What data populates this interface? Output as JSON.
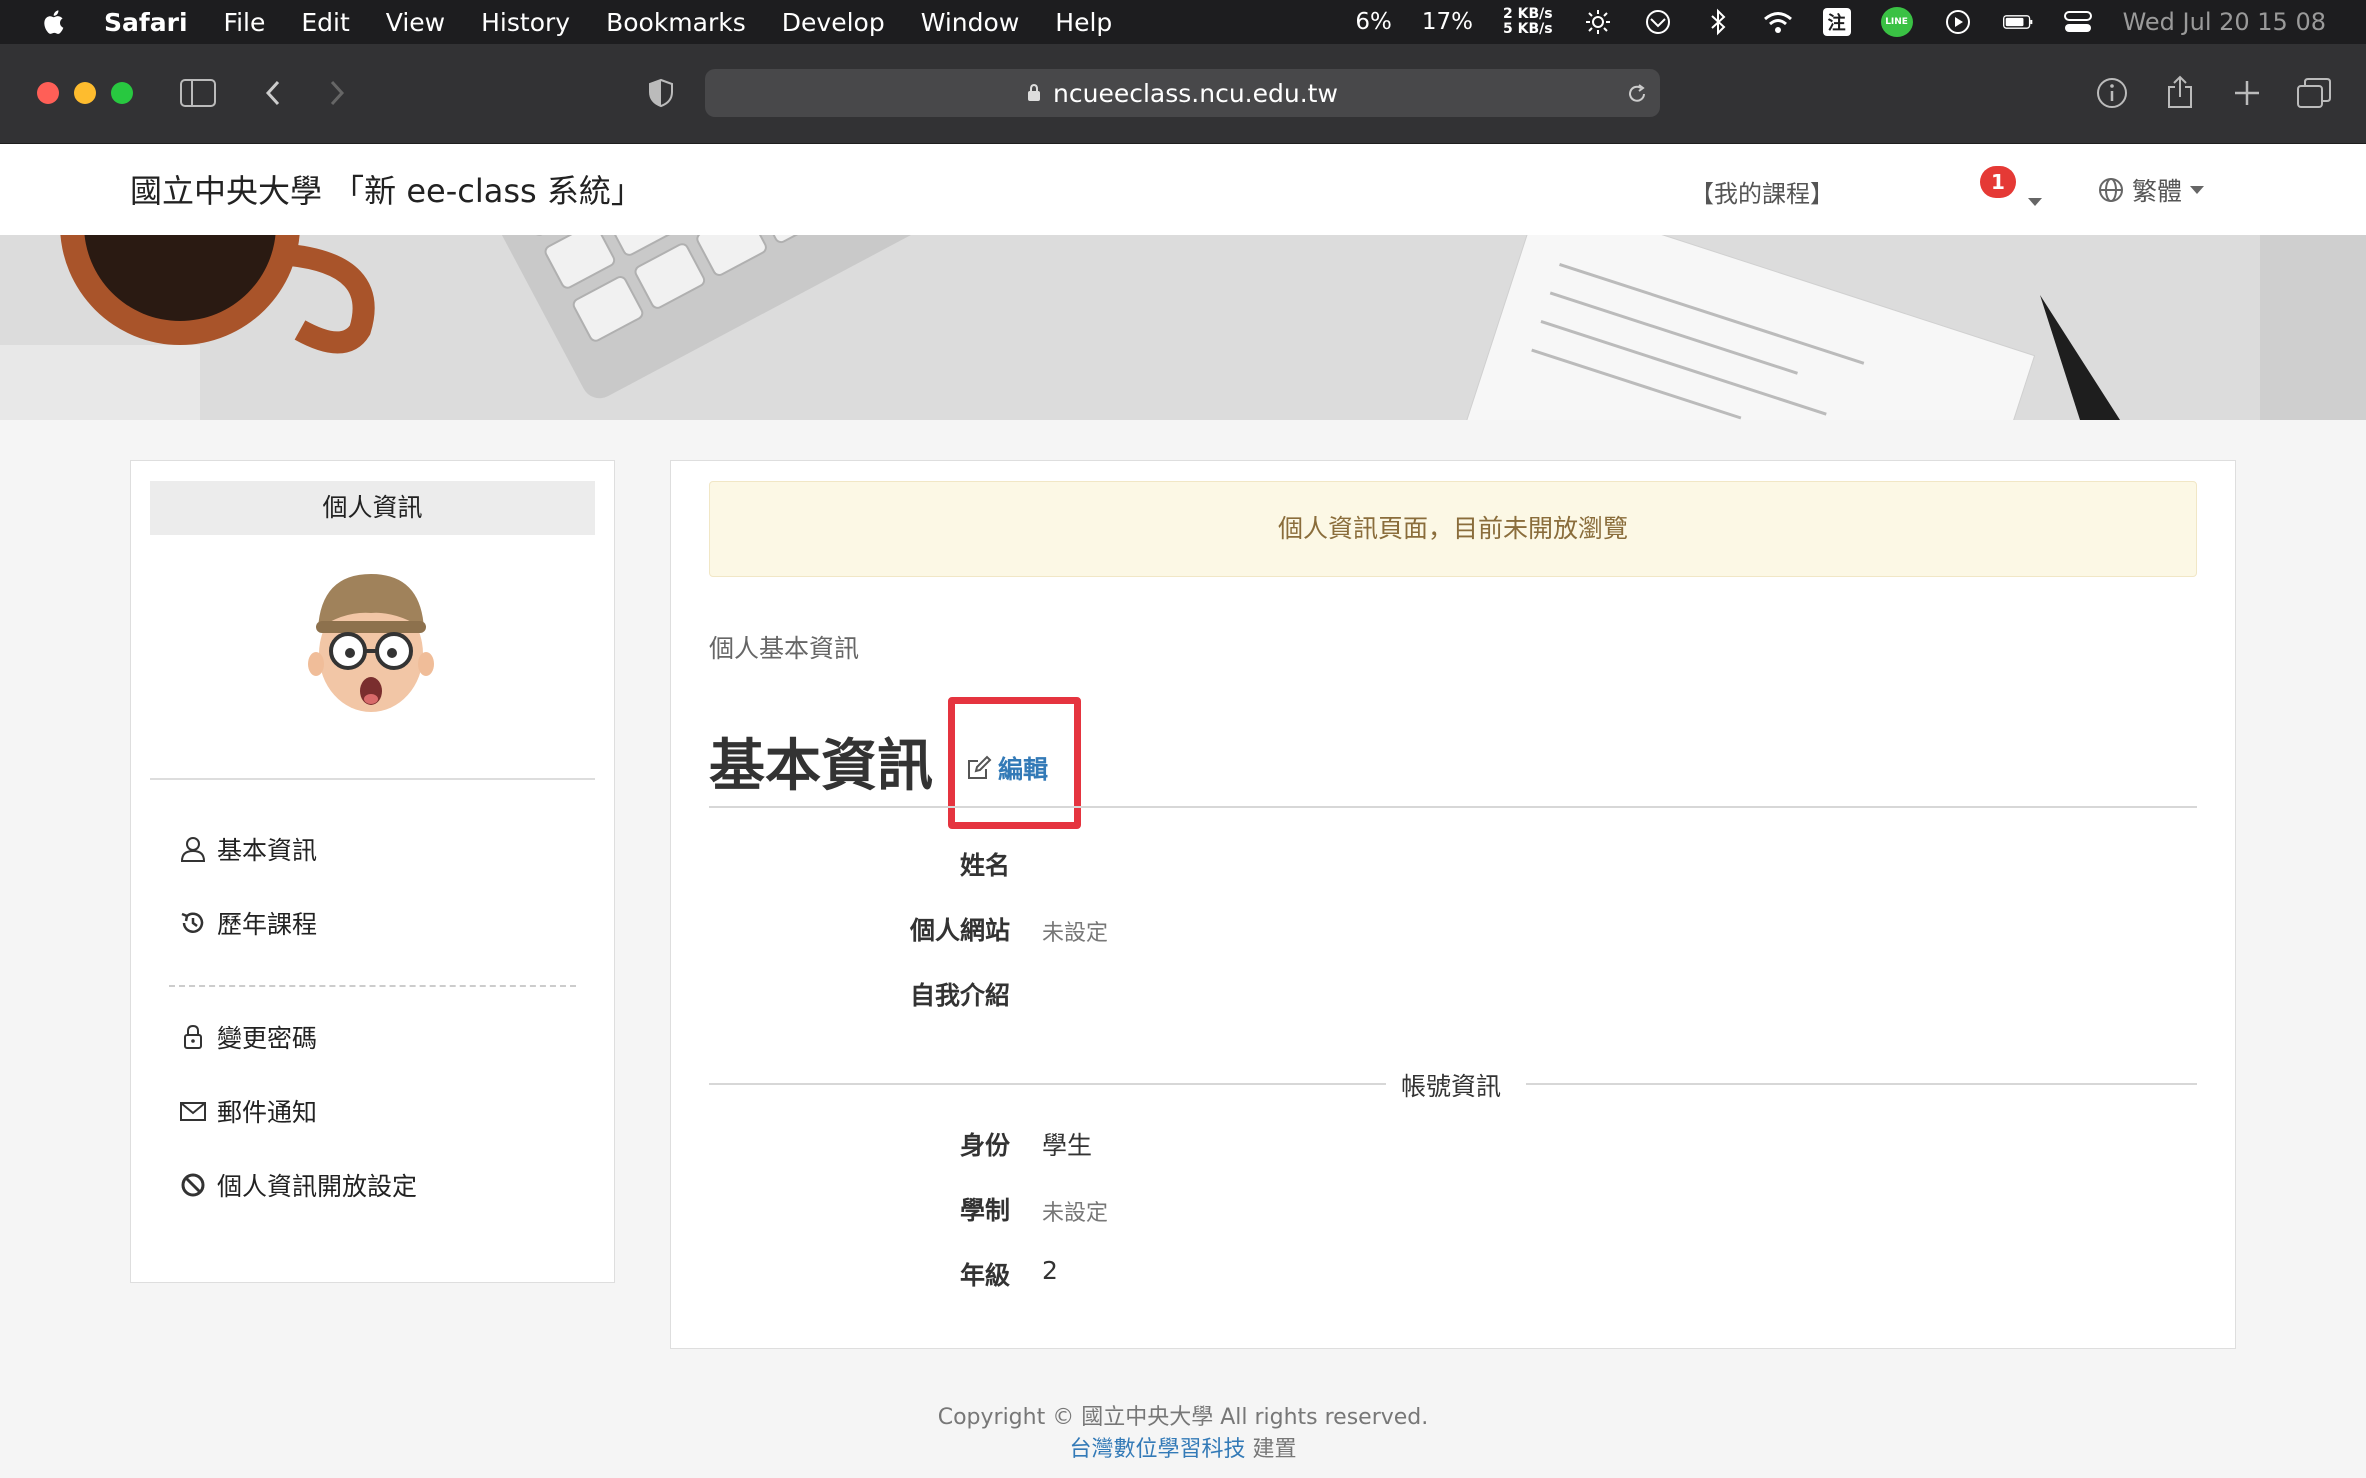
{
  "menubar": {
    "items": [
      "Safari",
      "File",
      "Edit",
      "View",
      "History",
      "Bookmarks",
      "Develop",
      "Window",
      "Help"
    ],
    "cpu": "6%",
    "mem": "17%",
    "net_up": "2 KB/s",
    "net_down": "5 KB/s",
    "input_method": "注",
    "line_label": "LINE",
    "datetime": "Wed Jul 20  15 08"
  },
  "browser": {
    "url": "ncueeclass.ncu.edu.tw"
  },
  "header": {
    "site_title": "國立中央大學 「新 ee-class 系統」",
    "my_courses": "【我的課程】",
    "notification_count": "1",
    "language": "繁體"
  },
  "sidebar": {
    "title": "個人資訊",
    "items": [
      {
        "label": "基本資訊",
        "icon": "user-icon"
      },
      {
        "label": "歷年課程",
        "icon": "history-icon"
      },
      {
        "label": "變更密碼",
        "icon": "lock-icon"
      },
      {
        "label": "郵件通知",
        "icon": "envelope-icon"
      },
      {
        "label": "個人資訊開放設定",
        "icon": "ban-icon"
      }
    ]
  },
  "main": {
    "notice": "個人資訊頁面，目前未開放瀏覽",
    "subheading": "個人基本資訊",
    "title": "基本資訊",
    "edit_label": "編輯",
    "basic_fields": [
      {
        "label": "姓名",
        "value": ""
      },
      {
        "label": "個人網站",
        "value": "未設定"
      },
      {
        "label": "自我介紹",
        "value": ""
      }
    ],
    "account_section_title": "帳號資訊",
    "account_fields": [
      {
        "label": "身份",
        "value": "學生"
      },
      {
        "label": "學制",
        "value": "未設定"
      },
      {
        "label": "年級",
        "value": "2"
      }
    ]
  },
  "footer": {
    "copyright": "Copyright © 國立中央大學 All rights reserved.",
    "builder_link": "台灣數位學習科技",
    "builder_suffix": " 建置"
  },
  "colors": {
    "accent": "#337ab7",
    "highlight_box": "#e5343f",
    "notice_bg": "#fcf8e5",
    "notice_text": "#8a6d3b"
  }
}
